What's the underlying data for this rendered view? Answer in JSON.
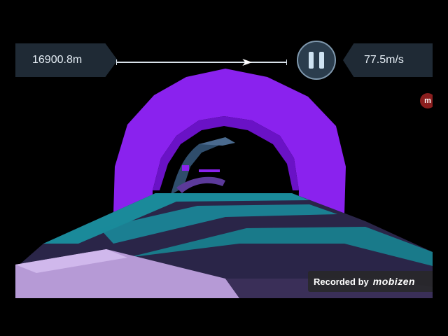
{
  "hud": {
    "distance": "16900.8m",
    "speed": "77.5m/s",
    "progress": 0.78
  },
  "overlay": {
    "recorded_label": "Recorded by",
    "recorder_brand": "mobizen",
    "side_badge": "m"
  },
  "icons": {
    "pause": "pause-icon",
    "progress_marker": "arrow-right-icon"
  },
  "colors": {
    "tunnel_ring": "#8a22ee",
    "track_teal": "#1a8a9a",
    "track_dark": "#2a2548",
    "track_light": "#b69ad6",
    "hud_bg": "#1f2a35"
  }
}
